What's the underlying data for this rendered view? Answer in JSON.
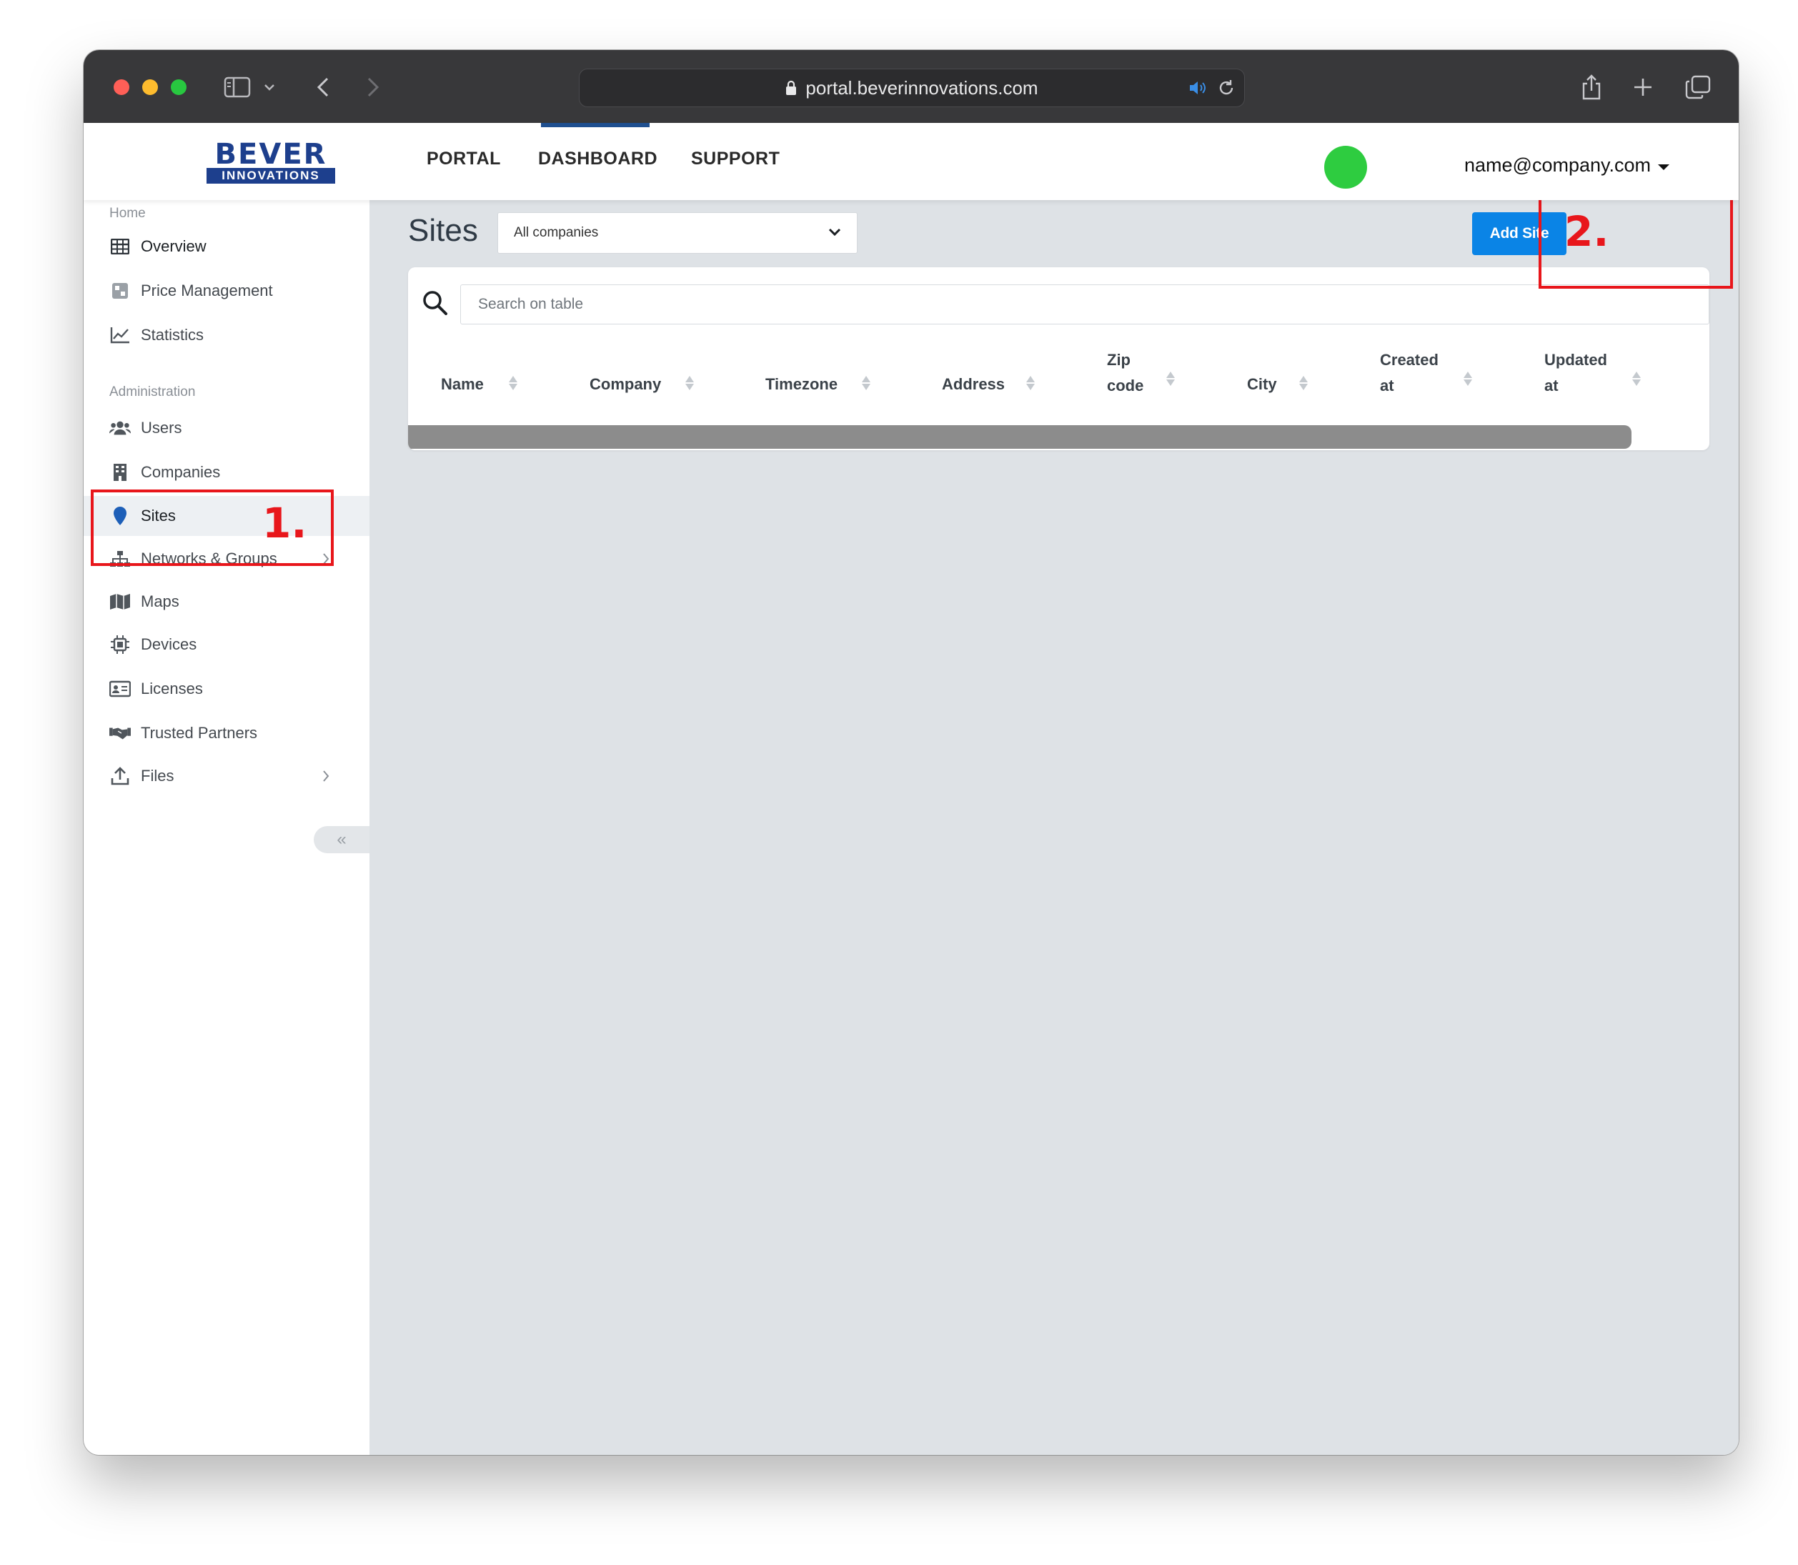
{
  "browser": {
    "url": "portal.beverinnovations.com"
  },
  "logo": {
    "word": "BEVER",
    "tagline": "INNOVATIONS"
  },
  "topnav": {
    "links": [
      "PORTAL",
      "DASHBOARD",
      "SUPPORT"
    ],
    "active": "DASHBOARD",
    "user_email": "name@company.com",
    "status_color": "#2ecc40"
  },
  "sidebar": {
    "sections": [
      {
        "title": "Home",
        "items": [
          {
            "label": "Overview",
            "icon": "table-icon"
          },
          {
            "label": "Price Management",
            "icon": "price-icon"
          },
          {
            "label": "Statistics",
            "icon": "line-chart-icon"
          }
        ]
      },
      {
        "title": "Administration",
        "items": [
          {
            "label": "Users",
            "icon": "users-icon"
          },
          {
            "label": "Companies",
            "icon": "building-icon"
          },
          {
            "label": "Sites",
            "icon": "map-pin-icon",
            "active": true
          },
          {
            "label": "Networks & Groups",
            "icon": "sitemap-icon",
            "has_children": true
          },
          {
            "label": "Maps",
            "icon": "map-icon"
          },
          {
            "label": "Devices",
            "icon": "chip-icon"
          },
          {
            "label": "Licenses",
            "icon": "id-card-icon"
          },
          {
            "label": "Trusted Partners",
            "icon": "handshake-icon"
          },
          {
            "label": "Files",
            "icon": "upload-icon",
            "has_children": true
          }
        ]
      }
    ],
    "collapse_label": "«"
  },
  "main": {
    "title": "Sites",
    "company_filter": {
      "selected": "All companies"
    },
    "add_button": "Add Site",
    "search": {
      "placeholder": "Search on table",
      "value": ""
    },
    "columns": [
      {
        "lines": [
          "Name"
        ]
      },
      {
        "lines": [
          "Company"
        ]
      },
      {
        "lines": [
          "Timezone"
        ]
      },
      {
        "lines": [
          "Address"
        ]
      },
      {
        "lines": [
          "Zip",
          "code"
        ]
      },
      {
        "lines": [
          "City"
        ]
      },
      {
        "lines": [
          "Created",
          "at"
        ]
      },
      {
        "lines": [
          "Updated",
          "at"
        ]
      }
    ],
    "rows": []
  },
  "annotations": {
    "step1": "1.",
    "step2": "2.",
    "color": "#e8161b"
  },
  "colors": {
    "primary_button": "#0a84e6",
    "brand": "#1d3f8d",
    "main_bg": "#dee2e6"
  }
}
